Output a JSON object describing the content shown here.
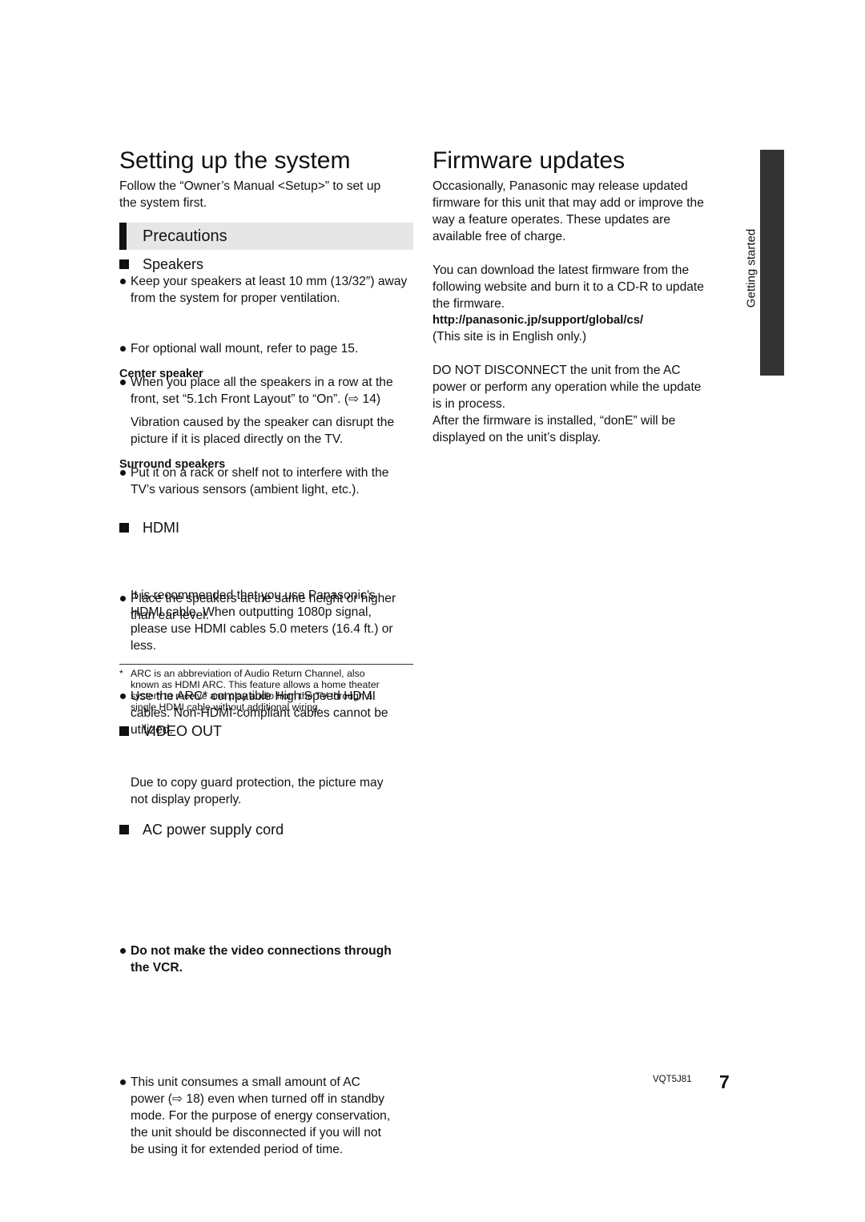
{
  "left": {
    "title": "Setting up the system",
    "intro": [
      "Follow the “Owner’s Manual <Setup>” to set up",
      "the system first."
    ],
    "precautions": "Precautions",
    "speakers": {
      "heading": "Speakers",
      "bullets": [
        [
          "Keep your speakers at least 10 mm (13/32″) away",
          "from the system for proper ventilation."
        ],
        [
          "For optional wall mount, refer to page 15."
        ],
        [
          "When you place all the speakers in a row at the",
          "front, set “5.1ch Front Layout” to “On”. (⇨ 14)"
        ]
      ],
      "center_heading": "Center speaker",
      "center_bullet": [
        "Put it on a rack or shelf not to interfere with the",
        "TV’s various sensors (ambient light, etc.)."
      ],
      "center_text": [
        "Vibration caused by the speaker can disrupt the",
        "picture if it is placed directly on the TV."
      ],
      "surround_heading": "Surround speakers",
      "surround_bullet": [
        "Place the speakers at the same height or higher",
        "than ear level."
      ]
    },
    "hdmi": {
      "heading": "HDMI",
      "bullet": [
        "Use the ARC* compatible High Speed HDMI",
        "cables. Non-HDMI-compliant cables cannot be",
        "utilized."
      ],
      "text": [
        "It is recommended that you use Panasonic’s",
        "HDMI cable. When outputting 1080p signal,",
        "please use HDMI cables 5.0 meters (16.4 ft.) or",
        "less."
      ]
    },
    "footnote_mark": "*",
    "footnote": [
      "ARC is an abbreviation of Audio Return Channel, also",
      "known as HDMI ARC. This feature allows a home theater",
      "system to receive and play audio from the TV through a",
      "single HDMI cable without additional wiring."
    ],
    "video": {
      "heading": "VIDEO OUT",
      "bullet": [
        "Do not make the video connections through",
        "the VCR."
      ],
      "text": [
        "Due to copy guard protection, the picture may",
        "not display properly."
      ]
    },
    "ac": {
      "heading": "AC power supply cord",
      "bullet": [
        "This unit consumes a small amount of AC",
        "power (⇨ 18) even when turned off in standby",
        "mode. For the purpose of energy conservation,",
        "the unit should be disconnected if you will not",
        "be using it for extended period of time."
      ]
    }
  },
  "right": {
    "title": "Firmware updates",
    "p1": [
      "Occasionally, Panasonic may release updated",
      "firmware for this unit that may add or improve the",
      "way a feature operates. These updates are",
      "available free of charge."
    ],
    "p2": [
      "You can download the latest firmware from the",
      "following website and burn it to a CD-R to update",
      "the firmware."
    ],
    "url": "http://panasonic.jp/support/global/cs/",
    "p3": [
      "(This site is in English only.)"
    ],
    "p4": [
      "DO NOT DISCONNECT the unit from the AC",
      "power or perform any operation while the update",
      "is in process."
    ],
    "p5": [
      "After the firmware is installed, “donE” will be",
      "displayed on the unit’s display."
    ]
  },
  "side_tab": "Getting started",
  "footer": {
    "code": "VQT5J81",
    "page": "7"
  }
}
